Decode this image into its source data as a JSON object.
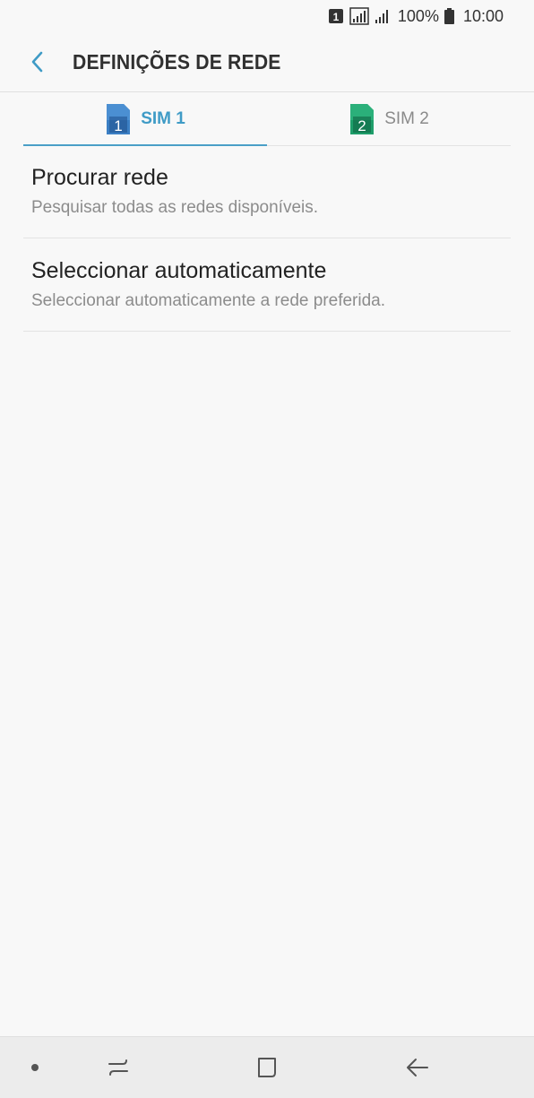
{
  "status_bar": {
    "sim_indicator": "1",
    "battery_percent": "100%",
    "time": "10:00",
    "icons": [
      "sim1-indicator-icon",
      "signal-icon",
      "signal-icon-2",
      "battery-icon"
    ]
  },
  "app_bar": {
    "title": "DEFINIÇÕES DE REDE",
    "back_icon": "chevron-left-icon"
  },
  "tabs": [
    {
      "label": "SIM 1",
      "sim_number": "1",
      "active": true,
      "color": "#3b7fc4"
    },
    {
      "label": "SIM 2",
      "sim_number": "2",
      "active": false,
      "color": "#1e9e6a"
    }
  ],
  "list": [
    {
      "title": "Procurar rede",
      "subtitle": "Pesquisar todas as redes disponíveis."
    },
    {
      "title": "Seleccionar automaticamente",
      "subtitle": "Seleccionar automaticamente a rede preferida."
    }
  ],
  "nav_bar": {
    "icons": [
      "dot-icon",
      "recent-apps-icon",
      "home-icon",
      "back-arrow-icon"
    ]
  },
  "colors": {
    "accent": "#3f9bc6",
    "background": "#f8f8f8"
  }
}
